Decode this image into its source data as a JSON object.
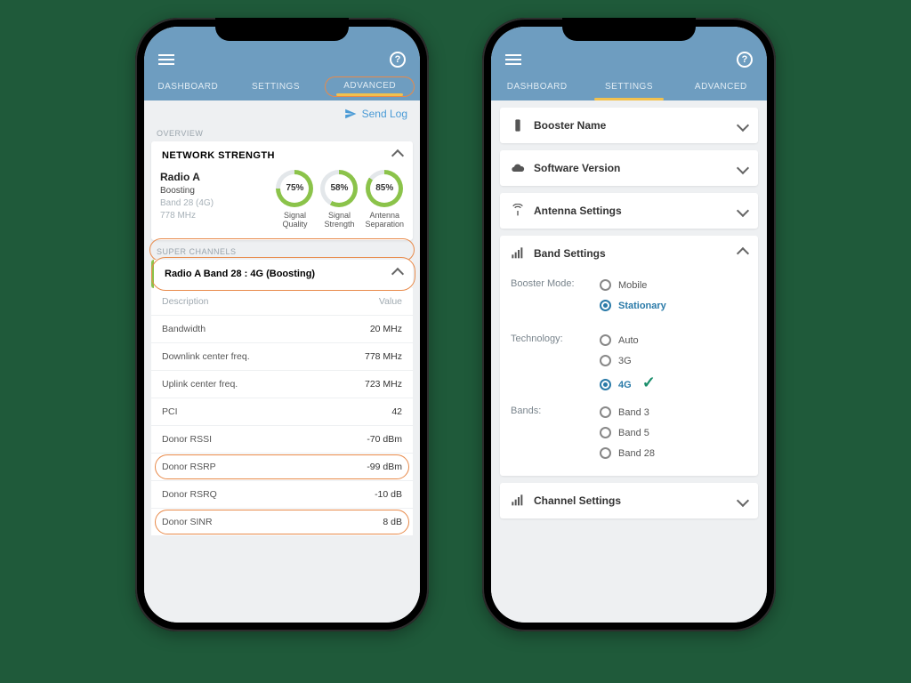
{
  "left": {
    "tabs": [
      "DASHBOARD",
      "SETTINGS",
      "ADVANCED"
    ],
    "active_tab": 2,
    "send_log": "Send Log",
    "overview_label": "OVERVIEW",
    "network_strength": {
      "title": "NETWORK STRENGTH",
      "radio": "Radio A",
      "status": "Boosting",
      "band_line": "Band 28 (4G)",
      "freq_line": "778 MHz",
      "gauges": [
        {
          "value": "75%",
          "pct": 75,
          "label1": "Signal",
          "label2": "Quality"
        },
        {
          "value": "58%",
          "pct": 58,
          "label1": "Signal",
          "label2": "Strength"
        },
        {
          "value": "85%",
          "pct": 85,
          "label1": "Antenna",
          "label2": "Separation"
        }
      ]
    },
    "super_channels_label": "SUPER CHANNELS",
    "channel_title": "Radio A Band 28 : 4G (Boosting)",
    "kv_header": {
      "k": "Description",
      "v": "Value"
    },
    "rows": [
      {
        "k": "Bandwidth",
        "v": "20 MHz",
        "hl": false
      },
      {
        "k": "Downlink center freq.",
        "v": "778 MHz",
        "hl": false
      },
      {
        "k": "Uplink center freq.",
        "v": "723 MHz",
        "hl": false
      },
      {
        "k": "PCI",
        "v": "42",
        "hl": false
      },
      {
        "k": "Donor RSSI",
        "v": "-70 dBm",
        "hl": false
      },
      {
        "k": "Donor RSRP",
        "v": "-99 dBm",
        "hl": true
      },
      {
        "k": "Donor RSRQ",
        "v": "-10 dB",
        "hl": false
      },
      {
        "k": "Donor SINR",
        "v": "8 dB",
        "hl": true
      }
    ]
  },
  "right": {
    "tabs": [
      "DASHBOARD",
      "SETTINGS",
      "ADVANCED"
    ],
    "active_tab": 1,
    "items": [
      {
        "icon": "device",
        "label": "Booster Name",
        "open": false
      },
      {
        "icon": "cloud",
        "label": "Software Version",
        "open": false
      },
      {
        "icon": "antenna",
        "label": "Antenna Settings",
        "open": false
      },
      {
        "icon": "bars",
        "label": "Band Settings",
        "open": true
      },
      {
        "icon": "bars",
        "label": "Channel Settings",
        "open": false
      }
    ],
    "band_settings": {
      "booster_mode_label": "Booster Mode:",
      "modes": [
        {
          "label": "Mobile",
          "selected": false
        },
        {
          "label": "Stationary",
          "selected": true
        }
      ],
      "technology_label": "Technology:",
      "techs": [
        {
          "label": "Auto",
          "selected": false,
          "check": false
        },
        {
          "label": "3G",
          "selected": false,
          "check": false
        },
        {
          "label": "4G",
          "selected": true,
          "check": true
        }
      ],
      "bands_label": "Bands:",
      "bands": [
        {
          "label": "Band 3",
          "selected": false
        },
        {
          "label": "Band 5",
          "selected": false
        },
        {
          "label": "Band 28",
          "selected": false
        }
      ]
    }
  }
}
